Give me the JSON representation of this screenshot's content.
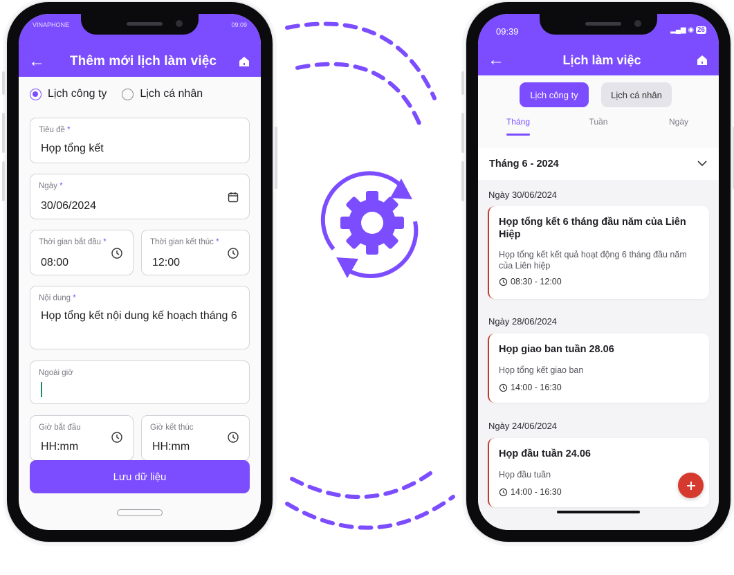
{
  "left": {
    "status": {
      "carrier": "VINAPHONE",
      "time": "09:09"
    },
    "header": {
      "title": "Thêm mới lịch làm việc"
    },
    "radio": {
      "company": "Lịch công ty",
      "personal": "Lịch cá nhân"
    },
    "form": {
      "title_label": "Tiêu đề",
      "title_value": "Họp tổng kết",
      "date_label": "Ngày",
      "date_value": "30/06/2024",
      "start_label": "Thời gian bắt đầu",
      "start_value": "08:00",
      "end_label": "Thời gian kết thúc",
      "end_value": "12:00",
      "content_label": "Nội dung",
      "content_value": "Họp tổng kết nội dung kế hoạch tháng 6",
      "overtime_label": "Ngoài giờ",
      "ot_start_label": "Giờ bắt đầu",
      "ot_start_placeholder": "HH:mm",
      "ot_end_label": "Giờ kết thúc",
      "ot_end_placeholder": "HH:mm",
      "required_mark": "*"
    },
    "save_label": "Lưu dữ liệu"
  },
  "right": {
    "status": {
      "time": "09:39",
      "battery": "26"
    },
    "header": {
      "title": "Lịch làm việc"
    },
    "segments": {
      "company": "Lịch công ty",
      "personal": "Lịch cá nhân"
    },
    "tabs": [
      "Tháng",
      "Tuần",
      "Ngày"
    ],
    "month": "Tháng 6 - 2024",
    "groups": [
      {
        "day": "Ngày 30/06/2024",
        "title": "Họp tổng kết 6 tháng đầu năm của Liên Hiệp",
        "desc": "Họp tổng kết kết quả hoạt động 6 tháng đầu năm của Liên hiệp",
        "time": "08:30 - 12:00"
      },
      {
        "day": "Ngày 28/06/2024",
        "title": "Họp giao ban tuần 28.06",
        "desc": "Họp tổng kết giao ban",
        "time": "14:00 - 16:30"
      },
      {
        "day": "Ngày 24/06/2024",
        "title": "Họp đầu tuần 24.06",
        "desc": "Họp đầu tuần",
        "time": "14:00 - 16:30"
      }
    ]
  },
  "colors": {
    "primary": "#7c4dff",
    "danger": "#d63a2e",
    "card_accent": "#c0392b"
  },
  "icons": [
    "back-arrow-icon",
    "home-icon",
    "calendar-icon",
    "clock-icon",
    "chevron-down-icon",
    "plus-icon",
    "sync-gear-icon"
  ]
}
